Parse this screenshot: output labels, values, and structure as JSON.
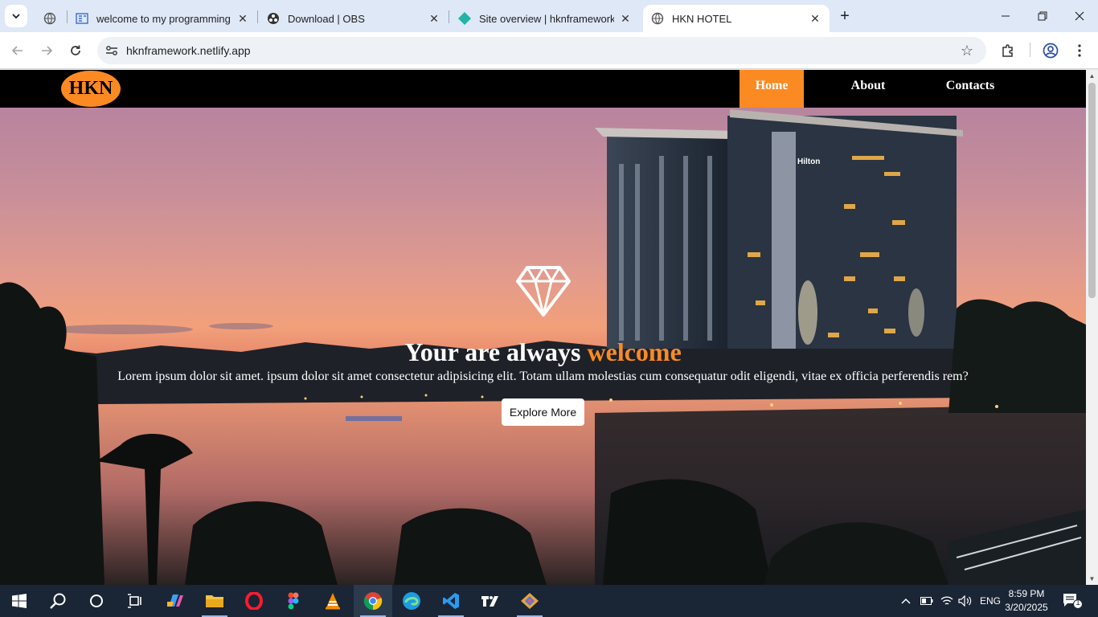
{
  "browser": {
    "tabs": [
      {
        "title": "welcome to my programming w",
        "icon": "web-icon",
        "active": false
      },
      {
        "title": "Download | OBS",
        "icon": "obs-icon",
        "active": false
      },
      {
        "title": "Site overview | hknframework | N",
        "icon": "netlify-icon",
        "active": false
      },
      {
        "title": "HKN HOTEL",
        "icon": "globe-icon",
        "active": true
      }
    ],
    "url": "hknframework.netlify.app"
  },
  "site": {
    "logo": "HKN",
    "nav": [
      {
        "label": "Home",
        "active": true
      },
      {
        "label": "About",
        "active": false
      },
      {
        "label": "Contacts",
        "active": false
      }
    ],
    "hero": {
      "headline_part1": "Your are always",
      "headline_accent": "welcome",
      "subtext": "Lorem ipsum dolor sit amet. ipsum dolor sit amet consectetur adipisicing elit. Totam ullam molestias cum consequatur odit eligendi, vitae ex officia perferendis rem?",
      "button": "Explore More",
      "building_sign": "Hilton"
    },
    "colors": {
      "accent": "#fb8a23",
      "nav_bg": "#000000"
    }
  },
  "taskbar": {
    "language": "ENG",
    "time": "8:59 PM",
    "date": "3/20/2025",
    "notification_count": "1"
  }
}
